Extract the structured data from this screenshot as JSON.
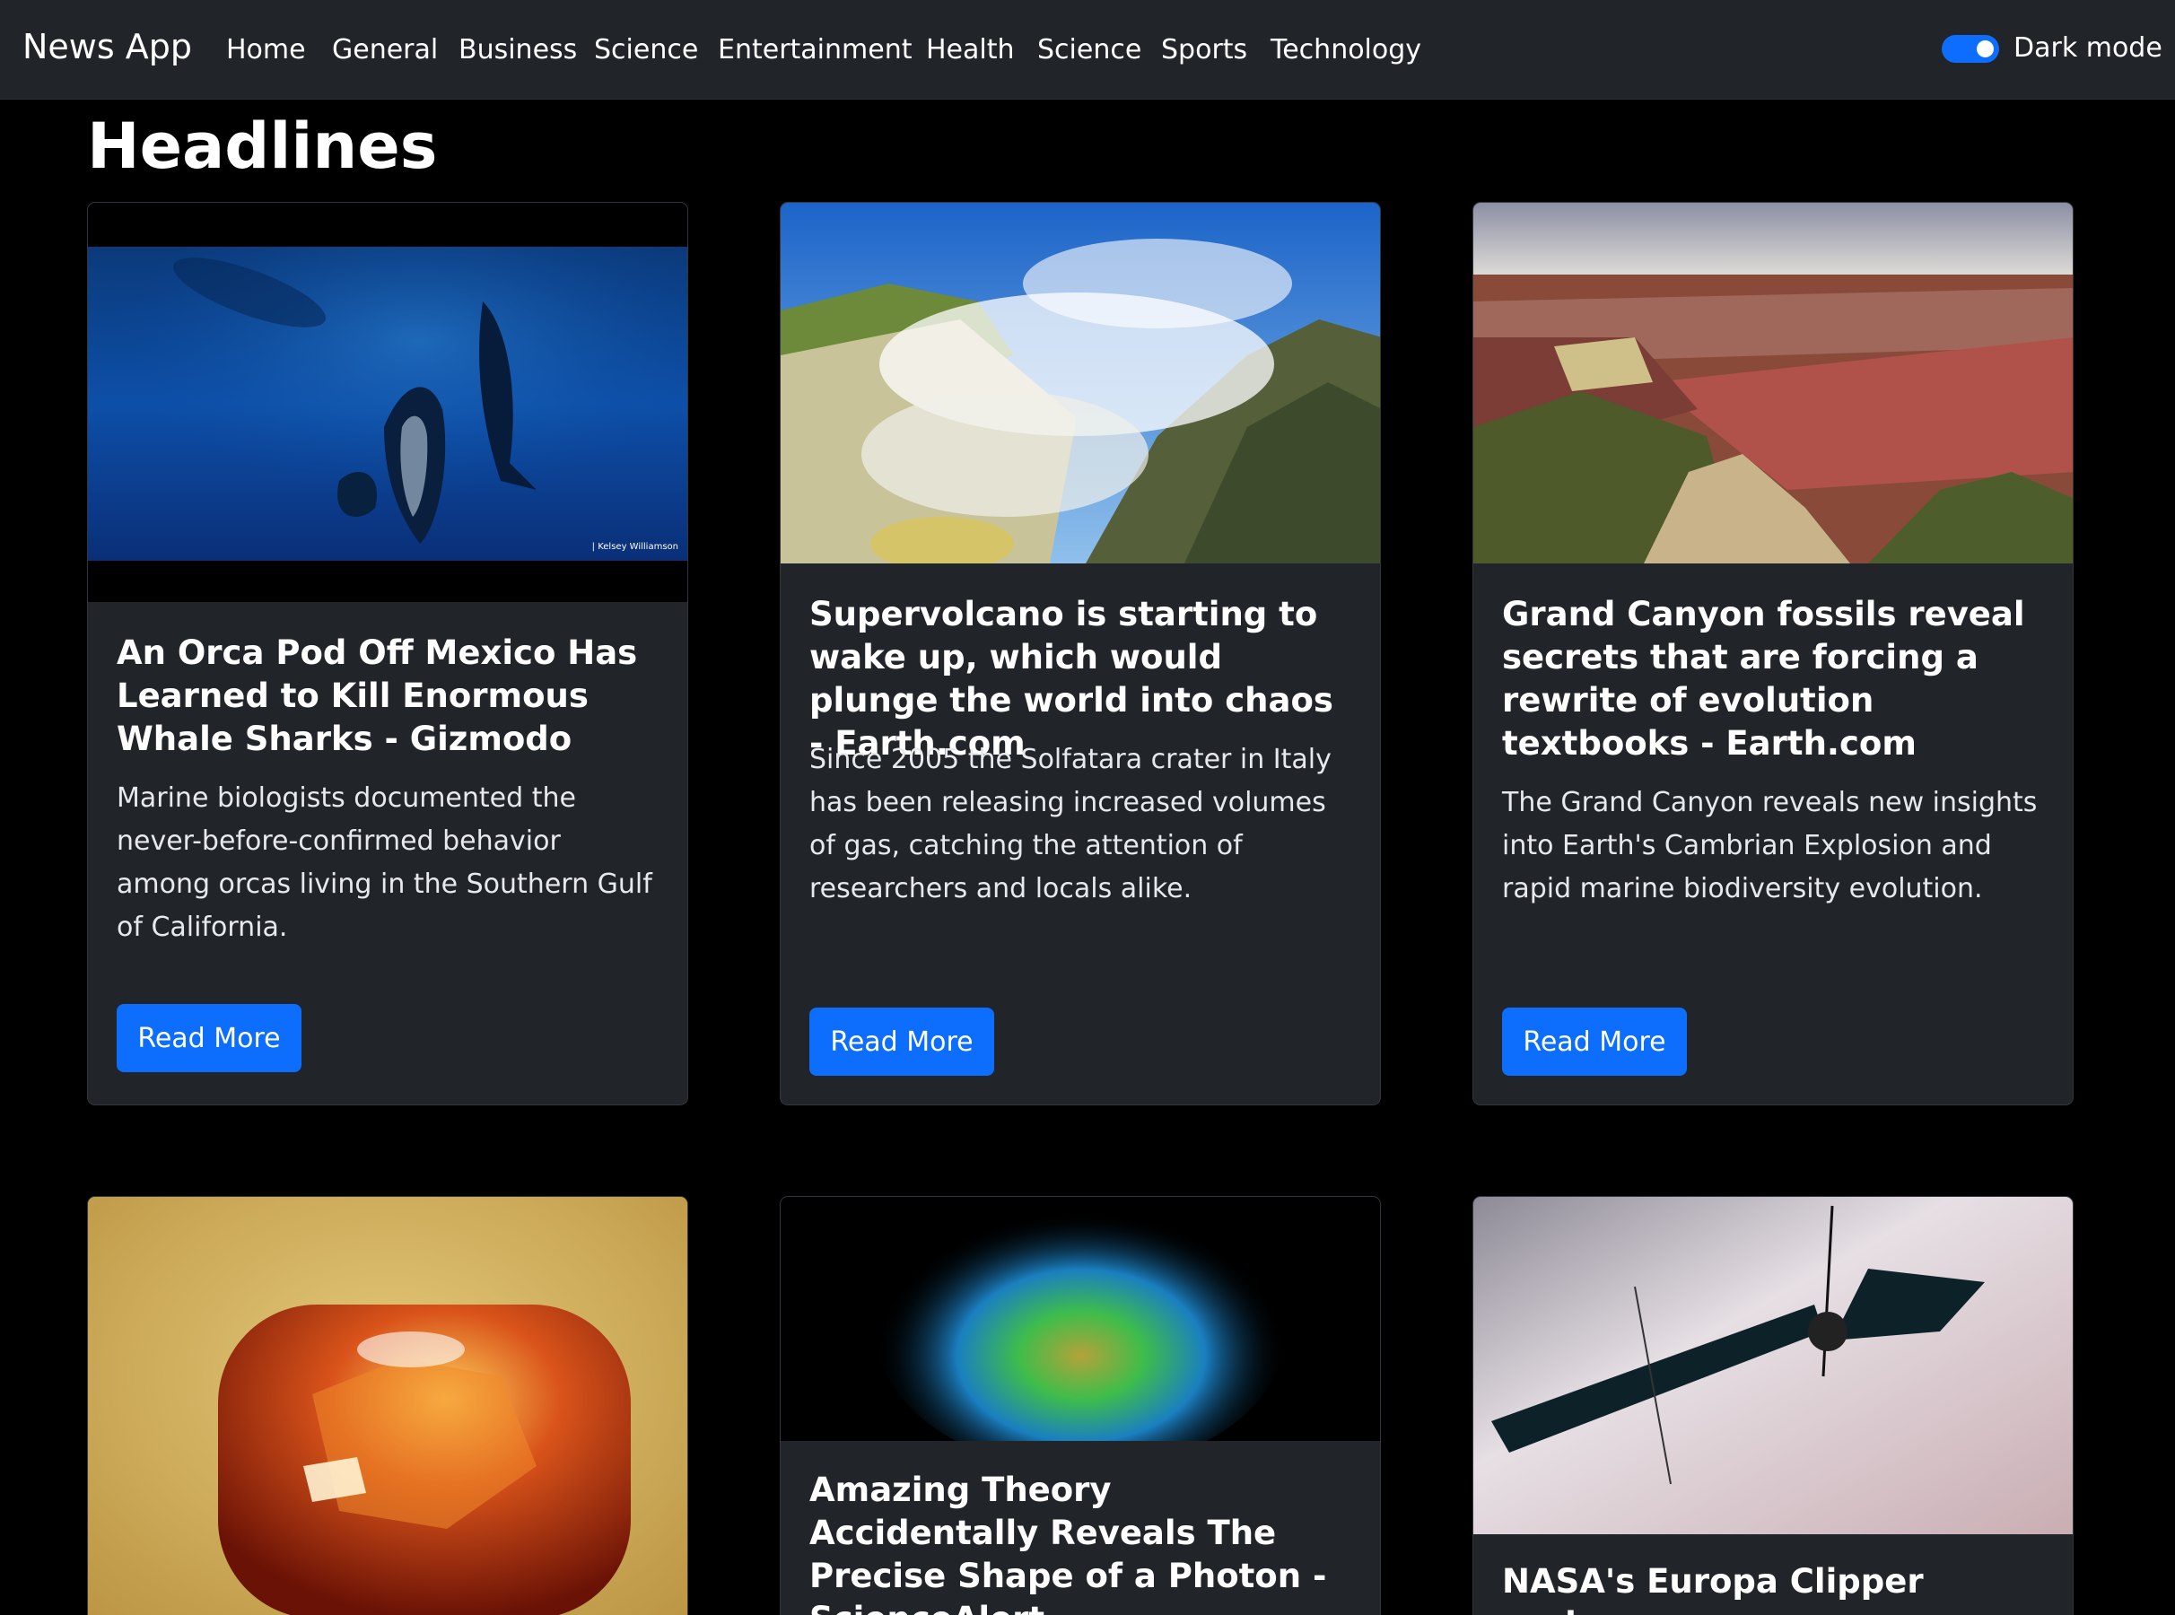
{
  "navbar": {
    "brand": "News App",
    "links": [
      "Home",
      "General",
      "Business",
      "Science",
      "Entertainment",
      "Health",
      "Science",
      "Sports",
      "Technology"
    ],
    "toggle_label": "Dark mode",
    "toggle_on": true
  },
  "page": {
    "heading": "Headlines"
  },
  "articles": [
    {
      "title": "An Orca Pod Off Mexico Has Learned to Kill Enormous Whale Sharks - Gizmodo",
      "description": "Marine biologists documented the never-before-confirmed behavior among orcas living in the Southern Gulf of California.",
      "button": "Read More",
      "image_credit": "| Kelsey Williamson"
    },
    {
      "title": "Supervolcano is starting to wake up, which would plunge the world into chaos - Earth.com",
      "description": "Since 2005 the Solfatara crater in Italy has been releasing increased volumes of gas, catching the attention of researchers and locals alike.",
      "button": "Read More"
    },
    {
      "title": "Grand Canyon fossils reveal secrets that are forcing a rewrite of evolution textbooks - Earth.com",
      "description": "The Grand Canyon reveals new insights into Earth's Cambrian Explosion and rapid marine biodiversity evolution.",
      "button": "Read More"
    },
    {
      "title": "",
      "description": ""
    },
    {
      "title": "Amazing Theory Accidentally Reveals The Precise Shape of a Photon - ScienceAlert"
    },
    {
      "title": "NASA's Europa Clipper probe"
    }
  ],
  "colors": {
    "navbar": "#212529",
    "card": "#212529",
    "accent": "#0d6efd",
    "background": "#000000"
  }
}
